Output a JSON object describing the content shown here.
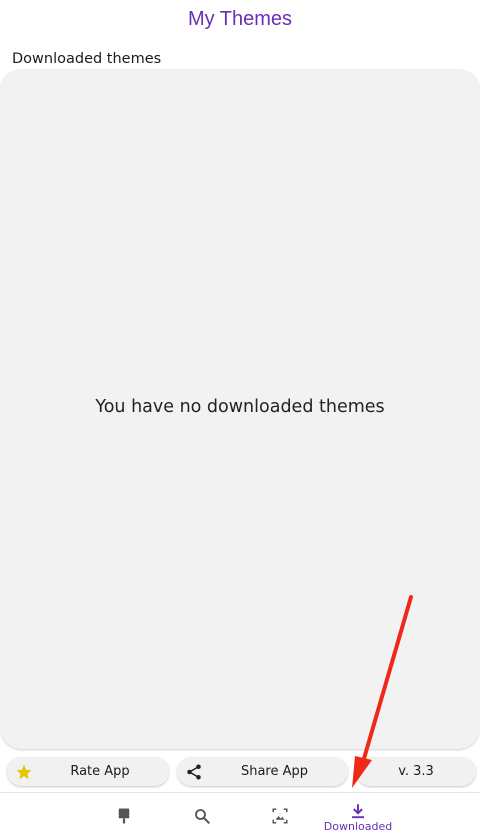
{
  "header": {
    "title": "My Themes"
  },
  "section": {
    "label": "Downloaded themes"
  },
  "panel": {
    "empty_message": "You have no downloaded themes"
  },
  "actions": {
    "rate": {
      "label": "Rate App",
      "icon": "star-icon"
    },
    "share": {
      "label": "Share App",
      "icon": "share-icon"
    },
    "version": {
      "label": "v. 3.3"
    }
  },
  "bottom_nav": {
    "items": [
      {
        "id": "themes",
        "icon": "paint-brush-icon",
        "label": ""
      },
      {
        "id": "search",
        "icon": "search-icon",
        "label": ""
      },
      {
        "id": "wallpaper",
        "icon": "image-frame-icon",
        "label": ""
      },
      {
        "id": "downloaded",
        "icon": "download-icon",
        "label": "Downloaded",
        "active": true
      }
    ]
  },
  "colors": {
    "accent": "#6a2fb5",
    "star": "#e8c400",
    "panel_bg": "#f2f2f2",
    "annotation_arrow": "#f02818"
  }
}
